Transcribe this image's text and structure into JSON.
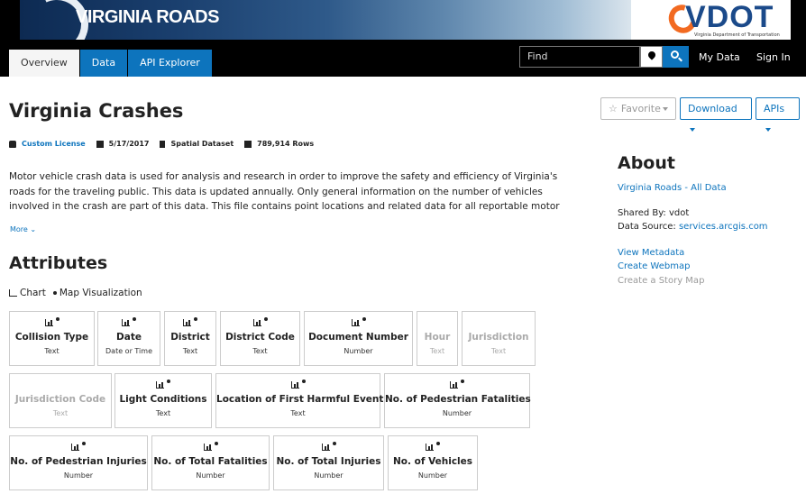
{
  "banner": {
    "brand": "VIRGINIA ROADS",
    "logo_text": "VDOT",
    "logo_sub": "Virginia Department of Transportation"
  },
  "nav": {
    "tabs": [
      {
        "label": "Overview",
        "active": true
      },
      {
        "label": "Data"
      },
      {
        "label": "API Explorer"
      }
    ],
    "search_placeholder": "Find",
    "my_data": "My Data",
    "sign_in": "Sign In"
  },
  "page": {
    "title": "Virginia Crashes",
    "meta": {
      "license": "Custom License",
      "date": "5/17/2017",
      "type": "Spatial Dataset",
      "rows": "789,914 Rows"
    },
    "buttons": {
      "favorite": "Favorite",
      "download": "Download",
      "apis": "APIs"
    },
    "description": "Motor vehicle crash data is used for analysis and research in order to improve the safety and efficiency of Virginia's roads for the traveling public. This data is updated annually. Only general information on the number of vehicles involved in the crash are part of this data. This file contains point locations and related data for all reportable motor",
    "more": "More"
  },
  "attributes": {
    "heading": "Attributes",
    "chart_label": "Chart",
    "map_label": "Map Visualization",
    "cards": [
      {
        "name": "Collision Type",
        "type": "Text"
      },
      {
        "name": "Date",
        "type": "Date or Time"
      },
      {
        "name": "District",
        "type": "Text"
      },
      {
        "name": "District Code",
        "type": "Text"
      },
      {
        "name": "Document Number",
        "type": "Number"
      },
      {
        "name": "Hour",
        "type": "Text"
      },
      {
        "name": "Jurisdiction",
        "type": "Text"
      },
      {
        "name": "Jurisdiction Code",
        "type": "Text"
      },
      {
        "name": "Light Conditions",
        "type": "Text"
      },
      {
        "name": "Location of First Harmful Event",
        "type": "Text"
      },
      {
        "name": "No. of Pedestrian Fatalities",
        "type": "Number"
      },
      {
        "name": "No. of Pedestrian Injuries",
        "type": "Number"
      },
      {
        "name": "No. of Total Fatalities",
        "type": "Number"
      },
      {
        "name": "No. of Total Injuries",
        "type": "Number"
      },
      {
        "name": "No. of Vehicles",
        "type": "Number"
      }
    ]
  },
  "about": {
    "heading": "About",
    "group_link": "Virginia Roads - All Data",
    "shared_by_label": "Shared By: ",
    "shared_by": "vdot",
    "source_label": "Data Source: ",
    "source": "services.arcgis.com",
    "view_metadata": "View Metadata",
    "create_webmap": "Create Webmap",
    "create_story_map": "Create a Story Map"
  },
  "colors": {
    "accent": "#0d74bd",
    "nav_bg": "#000000",
    "vdot_orange": "#f26a21"
  }
}
